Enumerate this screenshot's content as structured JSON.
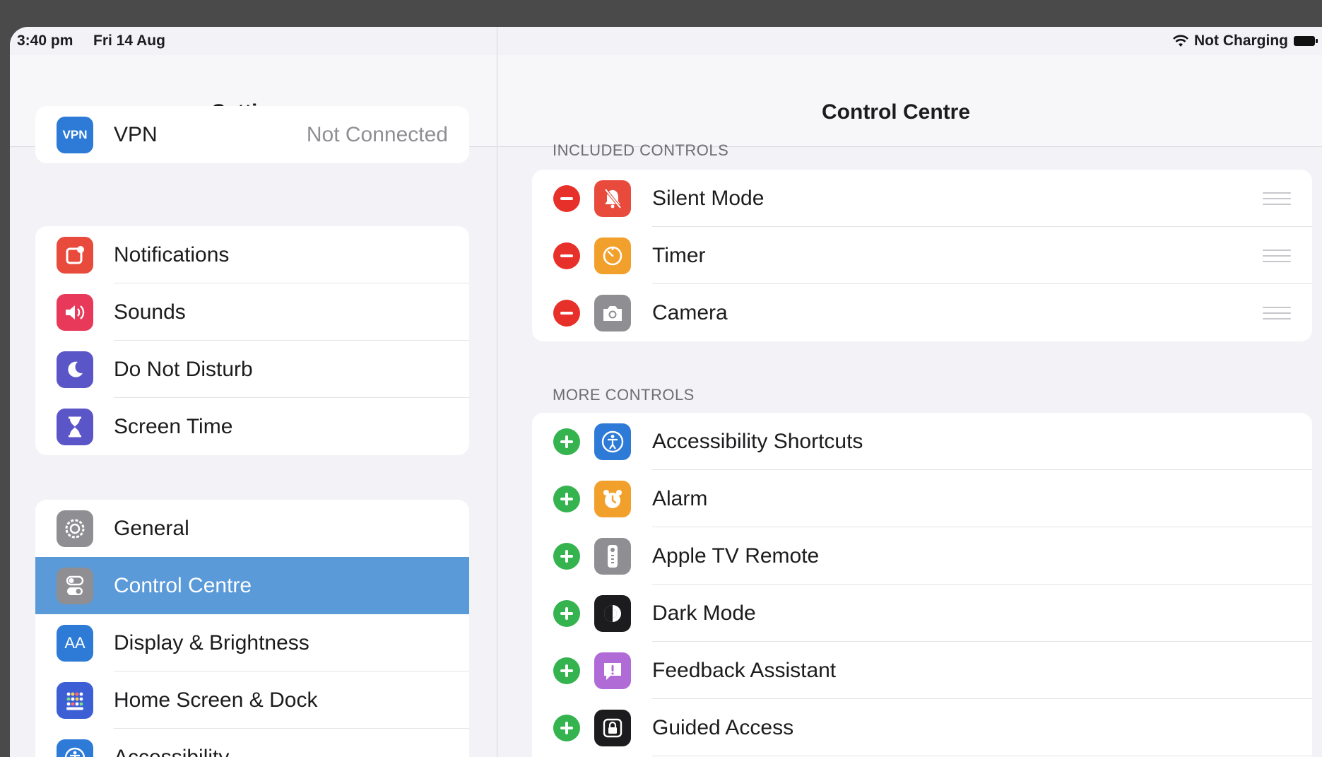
{
  "status_bar": {
    "time": "3:40 pm",
    "date": "Fri 14 Aug",
    "charging": "Not Charging"
  },
  "sidebar": {
    "title": "Settings",
    "groups": [
      {
        "items": [
          {
            "label": "VPN",
            "value": "Not Connected",
            "icon": "vpn-icon",
            "icon_text": "VPN",
            "color": "#2d7bd6"
          }
        ]
      },
      {
        "items": [
          {
            "label": "Notifications",
            "icon": "notifications-icon",
            "color": "#e84a3c"
          },
          {
            "label": "Sounds",
            "icon": "sounds-icon",
            "color": "#e8395a"
          },
          {
            "label": "Do Not Disturb",
            "icon": "moon-icon",
            "color": "#5b56c8"
          },
          {
            "label": "Screen Time",
            "icon": "hourglass-icon",
            "color": "#5b56c8"
          }
        ]
      },
      {
        "items": [
          {
            "label": "General",
            "icon": "gear-icon",
            "color": "#8e8e93"
          },
          {
            "label": "Control Centre",
            "icon": "toggles-icon",
            "color": "#8e8e93",
            "selected": true
          },
          {
            "label": "Display & Brightness",
            "icon": "display-icon",
            "icon_text": "AA",
            "color": "#2d7bd6"
          },
          {
            "label": "Home Screen & Dock",
            "icon": "home-grid-icon",
            "color": "#3d5fd6"
          },
          {
            "label": "Accessibility",
            "icon": "accessibility-icon",
            "color": "#2d7bd6"
          }
        ]
      }
    ]
  },
  "main": {
    "title": "Control Centre",
    "included_header": "INCLUDED CONTROLS",
    "included": [
      {
        "label": "Silent Mode",
        "icon": "bell-slash-icon",
        "color": "#e84a3c"
      },
      {
        "label": "Timer",
        "icon": "timer-icon",
        "color": "#f2a02c"
      },
      {
        "label": "Camera",
        "icon": "camera-icon",
        "color": "#8e8e93"
      }
    ],
    "more_header": "MORE CONTROLS",
    "more": [
      {
        "label": "Accessibility Shortcuts",
        "icon": "accessibility-icon",
        "color": "#2d7bd6"
      },
      {
        "label": "Alarm",
        "icon": "alarm-clock-icon",
        "color": "#f2a02c"
      },
      {
        "label": "Apple TV Remote",
        "icon": "tv-remote-icon",
        "color": "#8e8e93"
      },
      {
        "label": "Dark Mode",
        "icon": "dark-mode-icon",
        "color": "#1c1c1e"
      },
      {
        "label": "Feedback Assistant",
        "icon": "feedback-icon",
        "color": "#b06bd6"
      },
      {
        "label": "Guided Access",
        "icon": "lock-icon",
        "color": "#1c1c1e"
      }
    ]
  }
}
